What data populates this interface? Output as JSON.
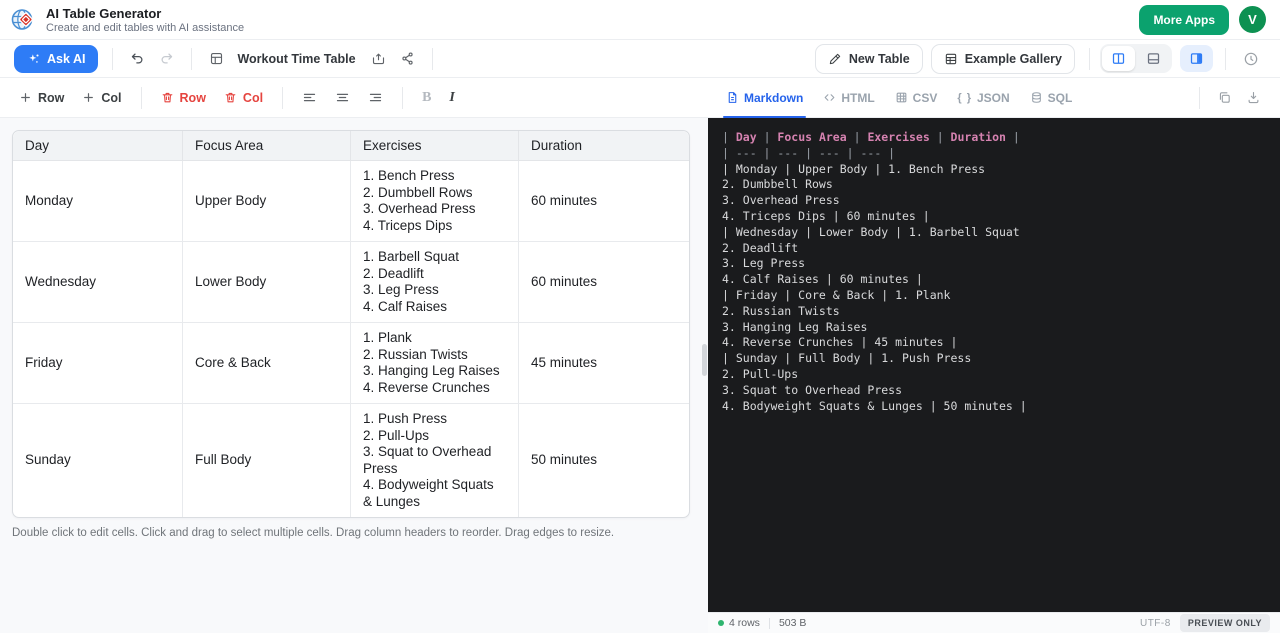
{
  "app": {
    "title": "AI Table Generator",
    "subtitle": "Create and edit tables with AI assistance",
    "more_apps": "More Apps",
    "avatar_initial": "V"
  },
  "toolbar": {
    "ask_ai": "Ask AI",
    "document_title": "Workout Time Table",
    "new_table": "New Table",
    "example_gallery": "Example Gallery"
  },
  "edit_toolbar": {
    "add_row": "Row",
    "add_col": "Col",
    "delete_row": "Row",
    "delete_col": "Col"
  },
  "table": {
    "columns": [
      "Day",
      "Focus Area",
      "Exercises",
      "Duration"
    ],
    "rows": [
      {
        "day": "Monday",
        "focus_area": "Upper Body",
        "exercises": [
          "1. Bench Press",
          "2. Dumbbell Rows",
          "3. Overhead Press",
          "4. Triceps Dips"
        ],
        "duration": "60 minutes"
      },
      {
        "day": "Wednesday",
        "focus_area": "Lower Body",
        "exercises": [
          "1. Barbell Squat",
          "2. Deadlift",
          "3. Leg Press",
          "4. Calf Raises"
        ],
        "duration": "60 minutes"
      },
      {
        "day": "Friday",
        "focus_area": "Core & Back",
        "exercises": [
          "1. Plank",
          "2. Russian Twists",
          "3. Hanging Leg Raises",
          "4. Reverse Crunches"
        ],
        "duration": "45 minutes"
      },
      {
        "day": "Sunday",
        "focus_area": "Full Body",
        "exercises": [
          "1. Push Press",
          "2. Pull-Ups",
          "3. Squat to Overhead Press",
          "4. Bodyweight Squats & Lunges"
        ],
        "duration": "50 minutes"
      }
    ],
    "help_text": "Double click to edit cells. Click and drag to select multiple cells. Drag column headers to reorder. Drag edges to resize."
  },
  "export_panel": {
    "tabs": [
      {
        "label": "Markdown"
      },
      {
        "label": "HTML"
      },
      {
        "label": "CSV"
      },
      {
        "label": "JSON"
      },
      {
        "label": "SQL"
      }
    ],
    "code_lines": [
      [
        {
          "t": "| ",
          "c": "pipe"
        },
        {
          "t": "Day",
          "c": "hdr"
        },
        {
          "t": " | ",
          "c": "pipe"
        },
        {
          "t": "Focus Area",
          "c": "hdr"
        },
        {
          "t": " | ",
          "c": "pipe"
        },
        {
          "t": "Exercises",
          "c": "hdr"
        },
        {
          "t": " | ",
          "c": "pipe"
        },
        {
          "t": "Duration",
          "c": "hdr"
        },
        {
          "t": " |",
          "c": "pipe"
        }
      ],
      [
        {
          "t": "| --- | --- | --- | --- |",
          "c": "pipe"
        }
      ],
      "| Monday | Upper Body | 1. Bench Press",
      "2. Dumbbell Rows",
      "3. Overhead Press",
      "4. Triceps Dips | 60 minutes |",
      "| Wednesday | Lower Body | 1. Barbell Squat",
      "2. Deadlift",
      "3. Leg Press",
      "4. Calf Raises | 60 minutes |",
      "| Friday | Core & Back | 1. Plank",
      "2. Russian Twists",
      "3. Hanging Leg Raises",
      "4. Reverse Crunches | 45 minutes |",
      "| Sunday | Full Body | 1. Push Press",
      "2. Pull-Ups",
      "3. Squat to Overhead Press",
      "4. Bodyweight Squats & Lunges | 50 minutes |"
    ],
    "status": {
      "rows": "4 rows",
      "size": "503 B",
      "encoding": "UTF-8",
      "badge": "PREVIEW ONLY"
    }
  },
  "colors": {
    "accent_blue": "#2e7cf6",
    "tab_active_blue": "#2563eb",
    "brand_green": "#0ba26e",
    "avatar_green": "#0d9152",
    "danger_red": "#e5443f",
    "code_background": "#1a1b1d",
    "code_header_pink": "#d582b0"
  }
}
